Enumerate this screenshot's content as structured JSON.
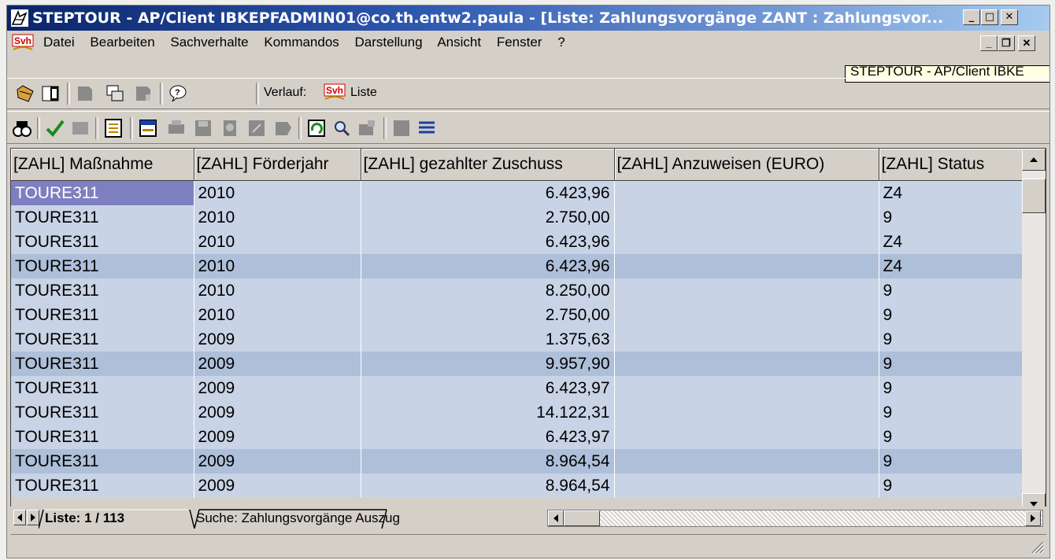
{
  "window": {
    "title": "STEPTOUR - AP/Client IBKEPFADMIN01@co.th.entw2.paula - [Liste: Zahlungsvorgänge ZANT : Zahlungsvor...",
    "minimize_label": "_",
    "maximize_label": "□",
    "close_label": "✕"
  },
  "menu": {
    "items": [
      "Datei",
      "Bearbeiten",
      "Sachverhalte",
      "Kommandos",
      "Darstellung",
      "Ansicht",
      "Fenster",
      "?"
    ],
    "mdi_minimize": "_",
    "mdi_restore": "❐",
    "mdi_close": "✕"
  },
  "tooltip": {
    "text": "STEPTOUR - AP/Client IBKE"
  },
  "toolbar": {
    "verlauf_label": "Verlauf:",
    "verlauf_value": "Liste",
    "icons": [
      "open-folder-icon",
      "split-window-icon",
      "book-icon",
      "copy-windows-icon",
      "book-gray-icon",
      "help-bubble-icon"
    ]
  },
  "toolbar2": {
    "icons": [
      "binoculars-icon",
      "checkmark-icon",
      "disabled-icon",
      "form-list-icon",
      "layout-icon",
      "print-icon",
      "disk-icon",
      "stamp-icon",
      "grid-icon",
      "export-icon",
      "refresh-icon",
      "magnifier-icon",
      "window-icon",
      "block-icon",
      "list-lines-icon"
    ]
  },
  "table": {
    "columns": [
      "[ZAHL] Maßnahme",
      "[ZAHL] Förderjahr",
      "[ZAHL] gezahlter Zuschuss",
      "[ZAHL] Anzuweisen (EURO)",
      "[ZAHL] Status"
    ],
    "rows": [
      [
        "TOURE311",
        "2010",
        "6.423,96",
        "",
        "Z4"
      ],
      [
        "TOURE311",
        "2010",
        "2.750,00",
        "",
        "9"
      ],
      [
        "TOURE311",
        "2010",
        "6.423,96",
        "",
        "Z4"
      ],
      [
        "TOURE311",
        "2010",
        "6.423,96",
        "",
        "Z4"
      ],
      [
        "TOURE311",
        "2010",
        "8.250,00",
        "",
        "9"
      ],
      [
        "TOURE311",
        "2010",
        "2.750,00",
        "",
        "9"
      ],
      [
        "TOURE311",
        "2009",
        "1.375,63",
        "",
        "9"
      ],
      [
        "TOURE311",
        "2009",
        "9.957,90",
        "",
        "9"
      ],
      [
        "TOURE311",
        "2009",
        "6.423,97",
        "",
        "9"
      ],
      [
        "TOURE311",
        "2009",
        "14.122,31",
        "",
        "9"
      ],
      [
        "TOURE311",
        "2009",
        "6.423,97",
        "",
        "9"
      ],
      [
        "TOURE311",
        "2009",
        "8.964,54",
        "",
        "9"
      ],
      [
        "TOURE311",
        "2009",
        "8.964,54",
        "",
        "9"
      ]
    ]
  },
  "tabs": {
    "active_label": "Liste:",
    "active_counter": "1 / 113",
    "inactive_label": "Suche: Zahlungsvorgänge Auszug"
  },
  "colors": {
    "row_bg": "#c8d3e6",
    "row_alt_bg": "#aebfd9",
    "selected_cell": "#7d7fc0",
    "titlebar_start": "#0a246a"
  }
}
